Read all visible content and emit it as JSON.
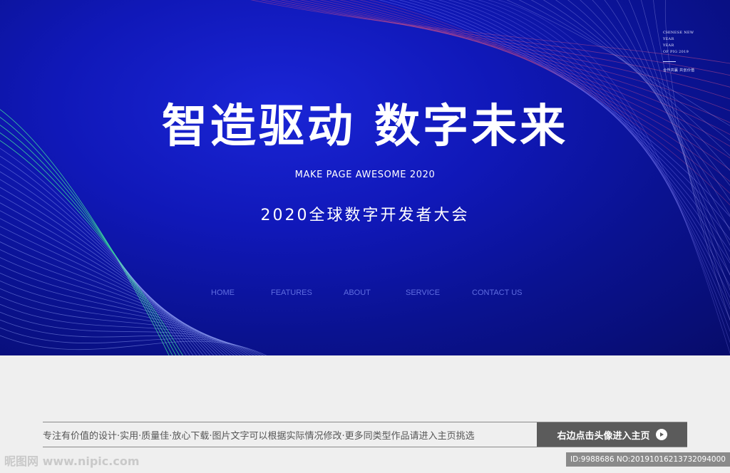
{
  "hero": {
    "corner_text": [
      "CHINESE NEW YEAR",
      "YEAR",
      "OF PIG 2019"
    ],
    "corner_slogan": "合作共赢 共创价值",
    "title": "智造驱动 数字未来",
    "subtitle_en": "MAKE PAGE AWESOME 2020",
    "subtitle_cn": "2020全球数字开发者大会"
  },
  "nav": {
    "items": [
      {
        "label": "HOME"
      },
      {
        "label": "FEATURES"
      },
      {
        "label": "ABOUT"
      },
      {
        "label": "SERVICE"
      },
      {
        "label": "CONTACT US"
      }
    ]
  },
  "footer": {
    "text": "专注有价值的设计·实用·质量佳·放心下载·图片文字可以根据实际情况修改·更多同类型作品请进入主页挑选",
    "button_label": "右边点击头像进入主页"
  },
  "watermark": "昵图网 www.nipic.com",
  "id_stamp": "ID:9988686 NO:20191016213732094000",
  "colors": {
    "hero_bg": "#1018b8",
    "nav_text": "#5f6de0",
    "accent_line_left": "#3ddc9c",
    "accent_line_right": "#c04a8a",
    "footer_button": "#5b5b5b"
  }
}
